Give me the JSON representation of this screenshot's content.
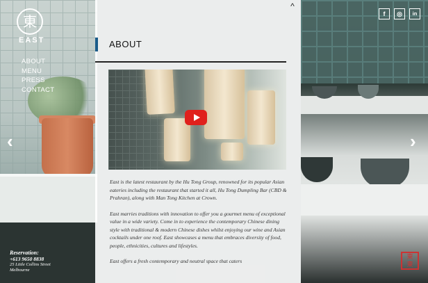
{
  "brand": {
    "logo_glyph": "東",
    "name": "EAST"
  },
  "nav": {
    "items": [
      "ABOUT",
      "MENU",
      "PRESS",
      "CONTACT"
    ]
  },
  "panel": {
    "title": "ABOUT",
    "paragraphs": [
      "East is the latest restaurant by the Hu Tong Group, renowned for its popular Asian eateries including the restaurant that started it all, Hu Tong Dumpling Bar (CBD & Prahran), along with Man Tong Kitchen at Crown.",
      "East marries traditions with innovation to offer you a gourmet menu of exceptional value in a wide variety. Come in to experience the contemporary Chinese dining style with traditional & modern Chinese dishes whilst enjoying our wine and Asian cocktails under one roof. East showcases a menu that embraces diversity of food, people, ethnicities, cultures and lifestyles.",
      "East offers a fresh contemporary and neutral space that caters"
    ]
  },
  "reservation": {
    "heading": "Reservation:",
    "phone": "+613 9650 8838",
    "address_line1": "25 Little Collins Street",
    "address_line2": "Melbourne"
  },
  "social": {
    "facebook": "f",
    "instagram": "◎",
    "linkedin": "in"
  },
  "icons": {
    "prev": "‹",
    "next": "›",
    "collapse": "^"
  },
  "colors": {
    "accent": "#1b5c8a",
    "play_button": "#e0201c"
  }
}
